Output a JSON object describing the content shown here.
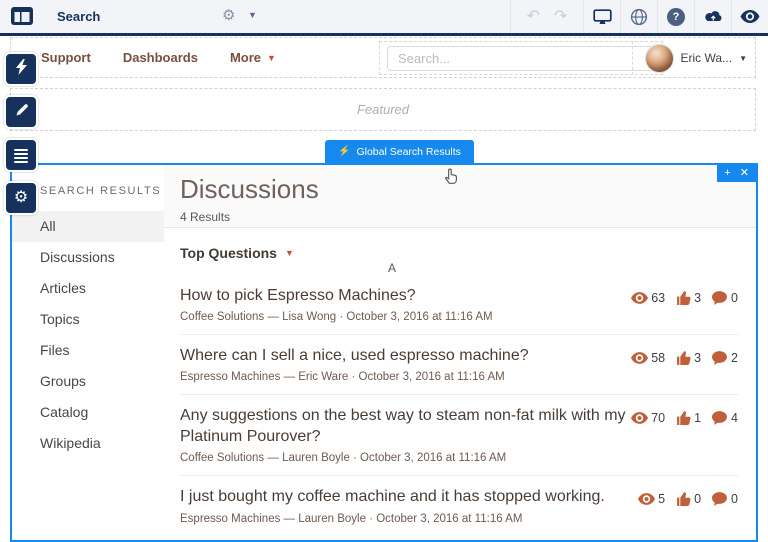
{
  "topbar": {
    "page_label": "Search",
    "undo_glyph": "↶",
    "redo_glyph": "↷",
    "help_glyph": "?"
  },
  "nav": {
    "links": [
      {
        "label": "Support"
      },
      {
        "label": "Dashboards"
      }
    ],
    "more_label": "More",
    "search_placeholder": "Search...",
    "user_name": "Eric Wa..."
  },
  "featured_label": "Featured",
  "component": {
    "tag_label": "Global Search Results",
    "corner": {
      "add": "+",
      "close": "✕"
    },
    "sidebar": {
      "header": "SEARCH RESULTS",
      "items": [
        {
          "label": "All",
          "selected": true
        },
        {
          "label": "Discussions"
        },
        {
          "label": "Articles"
        },
        {
          "label": "Topics"
        },
        {
          "label": "Files"
        },
        {
          "label": "Groups"
        },
        {
          "label": "Catalog"
        },
        {
          "label": "Wikipedia"
        }
      ]
    },
    "main": {
      "title": "Discussions",
      "result_count": "4 Results",
      "sort_label": "Top Questions",
      "divider_letter": "A",
      "results": [
        {
          "title": "How to pick Espresso Machines?",
          "meta": "Coffee Solutions — Lisa Wong · October 3, 2016 at 11:16 AM",
          "views": "63",
          "likes": "3",
          "comments": "0"
        },
        {
          "title": "Where can I sell a nice, used espresso machine?",
          "meta": "Espresso Machines — Eric Ware · October 3, 2016 at 11:16 AM",
          "views": "58",
          "likes": "3",
          "comments": "2"
        },
        {
          "title": "Any suggestions on the best way to steam non-fat milk with my Platinum Pourover?",
          "meta": "Coffee Solutions — Lauren Boyle · October 3, 2016 at 11:16 AM",
          "views": "70",
          "likes": "1",
          "comments": "4"
        },
        {
          "title": "I just bought my coffee machine and it has stopped working.",
          "meta": "Espresso Machines — Lauren Boyle · October 3, 2016 at 11:16 AM",
          "views": "5",
          "likes": "0",
          "comments": "0"
        }
      ]
    }
  },
  "colors": {
    "brand_blue": "#1589ee",
    "navy": "#16325c",
    "rust": "#c0603a",
    "nav_link_brown": "#7a4f3f"
  }
}
